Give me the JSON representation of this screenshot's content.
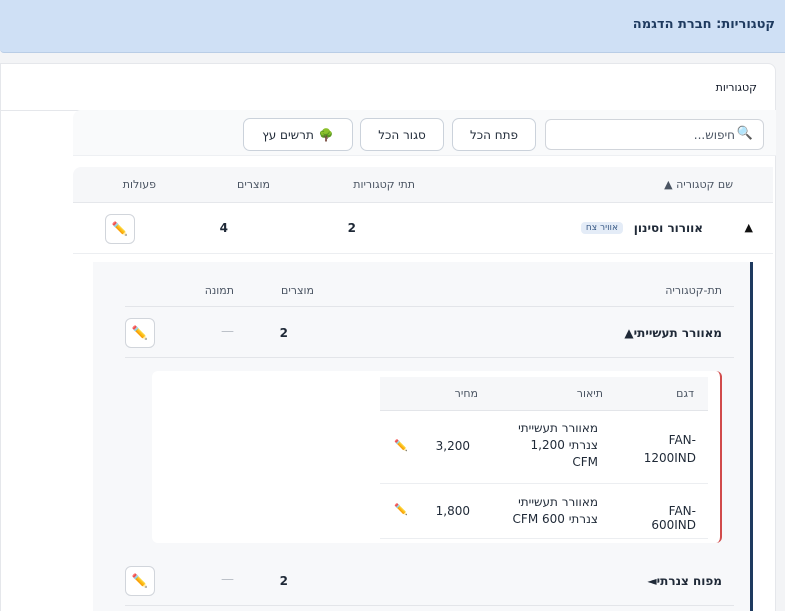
{
  "header": {
    "title": "קטגוריות: חברת הדגמה"
  },
  "card": {
    "label": "קטגוריות"
  },
  "toolbar": {
    "search_placeholder": "חיפוש...",
    "search_icon": "🔍",
    "open_all": "פתח הכל",
    "close_all": "סגור הכל",
    "tree_chart": "תרשים עץ",
    "tree_icon": "🌳"
  },
  "table": {
    "headers": {
      "name": "שם קטגוריה ▲",
      "subcategories": "תתי קטגוריות",
      "products": "מוצרים",
      "actions": "פעולות"
    },
    "rows": [
      {
        "expand": "▲",
        "name": "אוורור וסינון",
        "badge": "אוויר צח",
        "subcategories": "2",
        "products": "4",
        "edit_icon": "✏️"
      }
    ]
  },
  "subtable": {
    "headers": {
      "subcategory": "תת-קטגוריה",
      "products": "מוצרים",
      "image": "תמונה"
    },
    "rows": [
      {
        "name": "מאוורר תעשייתי▲",
        "products": "2",
        "image": "—",
        "edit_icon": "✏️"
      },
      {
        "name": "מפוח צנרתי◄",
        "products": "2",
        "image": "—",
        "edit_icon": "✏️"
      }
    ]
  },
  "products": {
    "headers": {
      "model": "דגם",
      "description": "תיאור",
      "price": "מחיר"
    },
    "rows": [
      {
        "model": "FAN-1200IND",
        "description": "מאוורר תעשייתי צנרתי 1,200 CFM",
        "price": "3,200",
        "edit_icon": "✏️"
      },
      {
        "model": "FAN-600IND",
        "description": "מאוורר תעשייתי צנרתי CFM 600",
        "price": "1,800",
        "edit_icon": "✏️"
      }
    ]
  },
  "colors": {
    "header_bg": "#cfe0f5",
    "accent": "#1e3a5f",
    "edit_orange": "#e06a1b",
    "product_border": "#d14b4b"
  }
}
